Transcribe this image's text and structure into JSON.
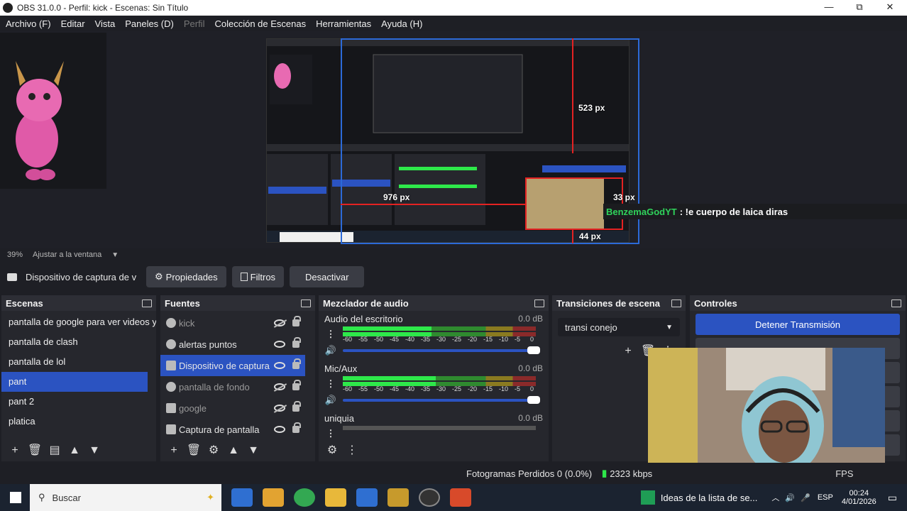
{
  "window": {
    "title": "OBS 31.0.0 - Perfil: kick - Escenas: Sin Título",
    "minimize_glyph": "—",
    "maximize_glyph": "⧉",
    "close_glyph": "✕"
  },
  "menu": {
    "items": [
      "Archivo (F)",
      "Editar",
      "Vista",
      "Paneles (D)",
      "Perfil",
      "Colección de Escenas",
      "Herramientas",
      "Ayuda (H)"
    ]
  },
  "preview": {
    "dim_top": "523 px",
    "dim_left": "976 px",
    "dim_right": "33 px",
    "dim_bottom": "44 px",
    "chat_user": "BenzemaGodYT",
    "chat_message": ": !e cuerpo de laica diras"
  },
  "zoom": {
    "percent": "39%",
    "mode": "Ajustar a la ventana"
  },
  "source_toolbar": {
    "selected_source": "Dispositivo de captura de v",
    "properties": "Propiedades",
    "filters": "Filtros",
    "deactivate": "Desactivar"
  },
  "scenes": {
    "title": "Escenas",
    "items": [
      "pantalla de google para ver videos y",
      "pantalla de clash",
      "pantalla de lol",
      "pant",
      "pant 2",
      "platica"
    ],
    "selected_index": 3
  },
  "sources": {
    "title": "Fuentes",
    "items": [
      {
        "label": "kick",
        "visible": false
      },
      {
        "label": "alertas puntos",
        "visible": true
      },
      {
        "label": "Dispositivo de captura",
        "visible": true
      },
      {
        "label": "pantalla de fondo",
        "visible": false
      },
      {
        "label": "google",
        "visible": false
      },
      {
        "label": "Captura de pantalla",
        "visible": true
      }
    ],
    "selected_index": 2
  },
  "mixer": {
    "title": "Mezclador de audio",
    "channels": [
      {
        "name": "Audio del escritorio",
        "db": "0.0 dB",
        "level": 0.46
      },
      {
        "name": "Mic/Aux",
        "db": "0.0 dB",
        "level": 0.48
      },
      {
        "name": "uniquia",
        "db": "0.0 dB",
        "level": 0.0
      }
    ],
    "ticks": [
      "-60",
      "-55",
      "-50",
      "-45",
      "-40",
      "-35",
      "-30",
      "-25",
      "-20",
      "-15",
      "-10",
      "-5",
      "0"
    ]
  },
  "transitions": {
    "title": "Transiciones de escena",
    "selected": "transi conejo"
  },
  "controls": {
    "title": "Controles",
    "stop_stream": "Detener Transmisión"
  },
  "status": {
    "dropped_frames": "Fotogramas Perdidos 0 (0.0%)",
    "bitrate": "2323 kbps",
    "fps": "FPS"
  },
  "taskbar": {
    "search_placeholder": "Buscar",
    "notification": "Ideas de la lista de se...",
    "lang": "ESP",
    "time": "00:24",
    "date": "4/01/2026"
  }
}
